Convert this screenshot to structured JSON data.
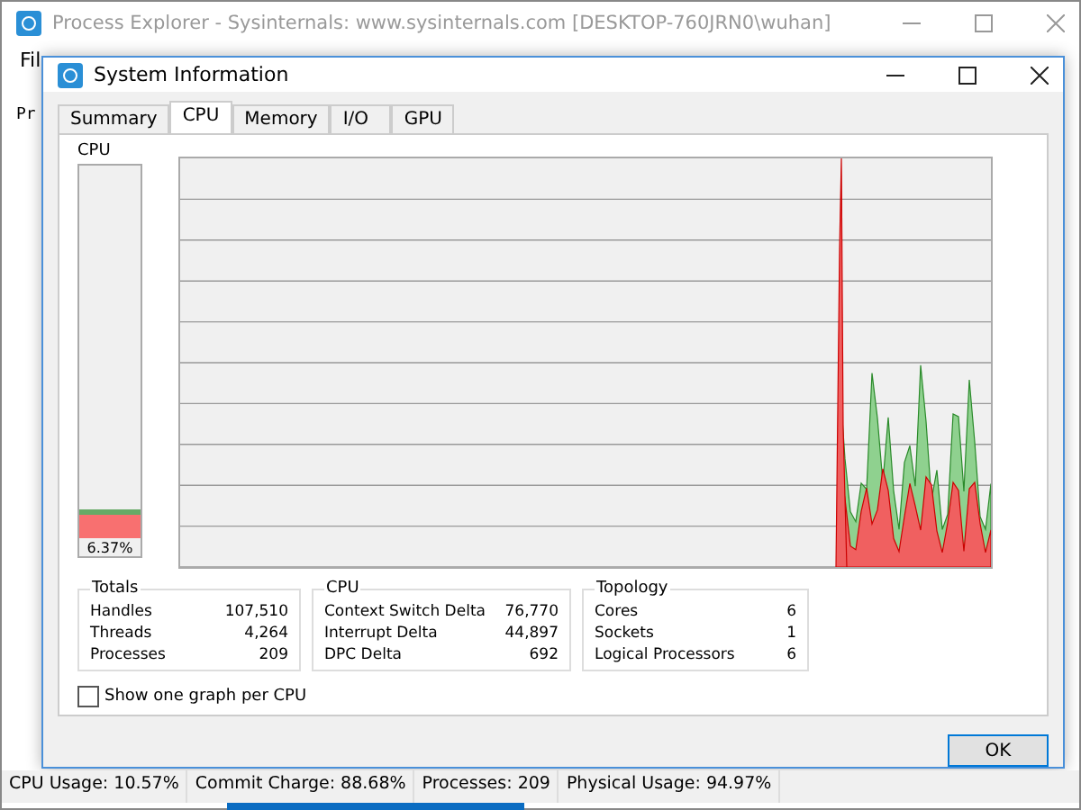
{
  "main_window": {
    "title": "Process Explorer - Sysinternals: www.sysinternals.com [DESKTOP-760JRN0\\wuhan]",
    "menu_visible": "Fil",
    "content_visible": "Pr"
  },
  "dialog": {
    "title": "System Information",
    "tabs": [
      {
        "label": "Summary",
        "selected": false
      },
      {
        "label": "CPU",
        "selected": true
      },
      {
        "label": "Memory",
        "selected": false
      },
      {
        "label": "I/O",
        "selected": false
      },
      {
        "label": "GPU",
        "selected": false
      }
    ],
    "meter": {
      "title": "CPU",
      "level": 0.0637,
      "reading": "6.37%"
    },
    "groups": [
      {
        "title": "Totals",
        "rows": [
          {
            "label": "Handles",
            "value": "107,510"
          },
          {
            "label": "Threads",
            "value": "4,264"
          },
          {
            "label": "Processes",
            "value": "209"
          }
        ]
      },
      {
        "title": "CPU",
        "rows": [
          {
            "label": "Context Switch Delta",
            "value": "76,770"
          },
          {
            "label": "Interrupt Delta",
            "value": "44,897"
          },
          {
            "label": "DPC Delta",
            "value": "692"
          }
        ]
      },
      {
        "title": "Topology",
        "rows": [
          {
            "label": "Cores",
            "value": "6"
          },
          {
            "label": "Sockets",
            "value": "1"
          },
          {
            "label": "Logical Processors",
            "value": "6"
          }
        ]
      }
    ],
    "checkbox": {
      "label": "Show one graph per CPU",
      "checked": false
    },
    "ok_button": "OK"
  },
  "status_bar": [
    "CPU Usage: 10.57%",
    "Commit Charge: 88.68%",
    "Processes: 209",
    "Physical Usage: 94.97%"
  ]
}
